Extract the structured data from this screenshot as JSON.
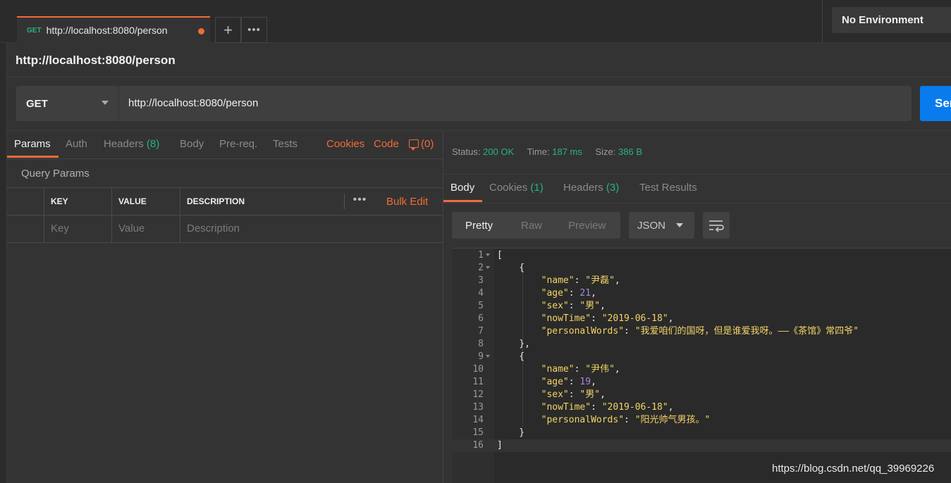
{
  "tab": {
    "method": "GET",
    "url": "http://localhost:8080/person"
  },
  "tab_actions": {
    "add": "+",
    "more": "•••"
  },
  "environment": "No Environment",
  "page_title": "http://localhost:8080/person",
  "request": {
    "method": "GET",
    "url": "http://localhost:8080/person",
    "send_label": "Send"
  },
  "request_tabs": {
    "params": "Params",
    "auth": "Auth",
    "headers": "Headers",
    "headers_count": "(8)",
    "body": "Body",
    "prereq": "Pre-req.",
    "tests": "Tests",
    "cookies": "Cookies",
    "code": "Code",
    "comments": "(0)"
  },
  "query_params": {
    "title": "Query Params",
    "columns": [
      "KEY",
      "VALUE",
      "DESCRIPTION"
    ],
    "placeholders": [
      "Key",
      "Value",
      "Description"
    ],
    "more": "•••",
    "bulk_edit": "Bulk Edit"
  },
  "response": {
    "status_label": "Status:",
    "status": "200 OK",
    "time_label": "Time:",
    "time": "187 ms",
    "size_label": "Size:",
    "size": "386 B"
  },
  "response_tabs": {
    "body": "Body",
    "cookies": "Cookies",
    "cookies_count": "(1)",
    "headers": "Headers",
    "headers_count": "(3)",
    "test_results": "Test Results"
  },
  "view_modes": {
    "pretty": "Pretty",
    "raw": "Raw",
    "preview": "Preview"
  },
  "format": "JSON",
  "json_lines": [
    {
      "n": "1",
      "fold": true,
      "html": "["
    },
    {
      "n": "2",
      "fold": true,
      "html": "    {"
    },
    {
      "n": "3",
      "html": "        <span class='k'>\"name\"</span>: <span class='s'>\"尹磊\"</span>,"
    },
    {
      "n": "4",
      "html": "        <span class='k'>\"age\"</span>: <span class='n'>21</span>,"
    },
    {
      "n": "5",
      "html": "        <span class='k'>\"sex\"</span>: <span class='s'>\"男\"</span>,"
    },
    {
      "n": "6",
      "html": "        <span class='k'>\"nowTime\"</span>: <span class='s'>\"2019-06-18\"</span>,"
    },
    {
      "n": "7",
      "html": "        <span class='k'>\"personalWords\"</span>: <span class='s'>\"我爱咱们的国呀，但是谁爱我呀。——《茶馆》常四爷\"</span>"
    },
    {
      "n": "8",
      "html": "    },"
    },
    {
      "n": "9",
      "fold": true,
      "html": "    {"
    },
    {
      "n": "10",
      "html": "        <span class='k'>\"name\"</span>: <span class='s'>\"尹伟\"</span>,"
    },
    {
      "n": "11",
      "html": "        <span class='k'>\"age\"</span>: <span class='n'>19</span>,"
    },
    {
      "n": "12",
      "html": "        <span class='k'>\"sex\"</span>: <span class='s'>\"男\"</span>,"
    },
    {
      "n": "13",
      "html": "        <span class='k'>\"nowTime\"</span>: <span class='s'>\"2019-06-18\"</span>,"
    },
    {
      "n": "14",
      "html": "        <span class='k'>\"personalWords\"</span>: <span class='s'>\"阳光帅气男孩。\"</span>"
    },
    {
      "n": "15",
      "html": "    }"
    },
    {
      "n": "16",
      "html": "]",
      "current": true
    }
  ],
  "watermark": "https://blog.csdn.net/qq_39969226"
}
